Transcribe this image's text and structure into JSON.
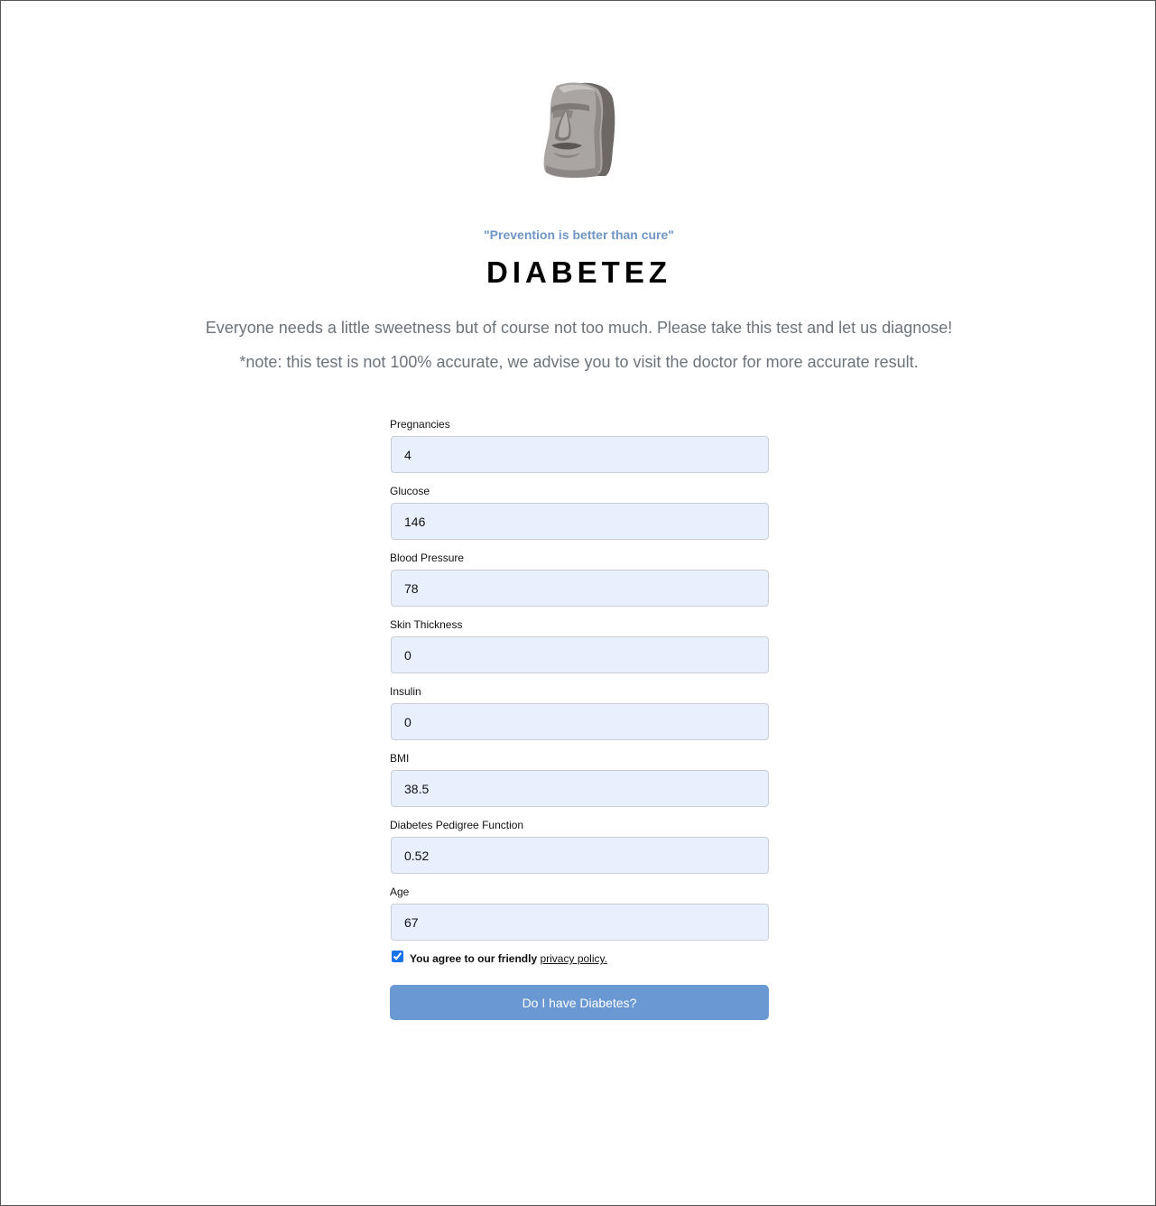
{
  "header": {
    "logo_icon": "moai-statue-icon",
    "tagline": "\"Prevention is better than cure\"",
    "brand": "DIABETEZ",
    "lead_line_1": "Everyone needs a little sweetness but of course not too much. Please take this test and let us diagnose!",
    "lead_line_2": "*note: this test is not 100% accurate, we advise you to visit the doctor for more accurate result."
  },
  "form": {
    "fields": [
      {
        "label": "Pregnancies",
        "value": "4"
      },
      {
        "label": "Glucose",
        "value": "146"
      },
      {
        "label": "Blood Pressure",
        "value": "78"
      },
      {
        "label": "Skin Thickness",
        "value": "0"
      },
      {
        "label": "Insulin",
        "value": "0"
      },
      {
        "label": "BMI",
        "value": "38.5"
      },
      {
        "label": "Diabetes Pedigree Function",
        "value": "0.52"
      },
      {
        "label": "Age",
        "value": "67"
      }
    ],
    "agree_checked": true,
    "agree_text": "You agree to our friendly ",
    "policy_link_text": "privacy policy.",
    "submit_label": "Do I have Diabetes?"
  },
  "colors": {
    "accent": "#6a98d2",
    "tagline": "#6f95c6",
    "input_bg": "#e8f0fe",
    "muted_text": "#6c737a"
  }
}
